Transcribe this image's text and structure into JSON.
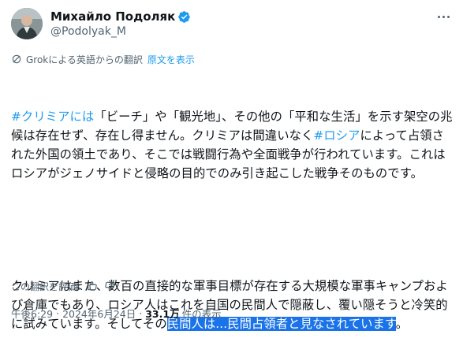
{
  "author": {
    "display_name": "Михайло Подоляк",
    "handle": "@Podolyak_M"
  },
  "translation_bar": {
    "label": "Grokによる英語からの翻訳",
    "original_link": "原文を表示"
  },
  "tweet": {
    "p1": {
      "hashtag1": "#クリミアには",
      "text1": "「ビーチ」や「観光地」、その他の「平和な生活」を示す架空の兆候は存在せず、存在し得ません。クリミアは間違いなく",
      "hashtag2": "#ロシア",
      "text2": "によって占領された外国の領土であり、そこでは戦闘行為や全面戦争が行われています。これはロシアがジェノサイドと侵略の目的でのみ引き起こした戦争そのものです。"
    },
    "p2": {
      "text": "クリミアはまた、数百の直接的な軍事目標が存在する大規模な軍事キャンプおよび倉庫でもあり、ロシア人はこれを自国の民間人で隠蔽し、覆い隠そうと冷笑的に試みています。そしてその",
      "highlighted": "民間人は...民間占領者と見なされています",
      "end": "。"
    }
  },
  "rate_translation": {
    "label": "この翻訳を評価:"
  },
  "meta": {
    "time": "午後6:29",
    "separator": "·",
    "date": "2024年6月24日",
    "views_count": "33.1万",
    "views_label": "件の表示"
  },
  "colors": {
    "link": "#1d9bf0",
    "highlight": "#1a73e8",
    "verified": "#1d9bf0"
  }
}
